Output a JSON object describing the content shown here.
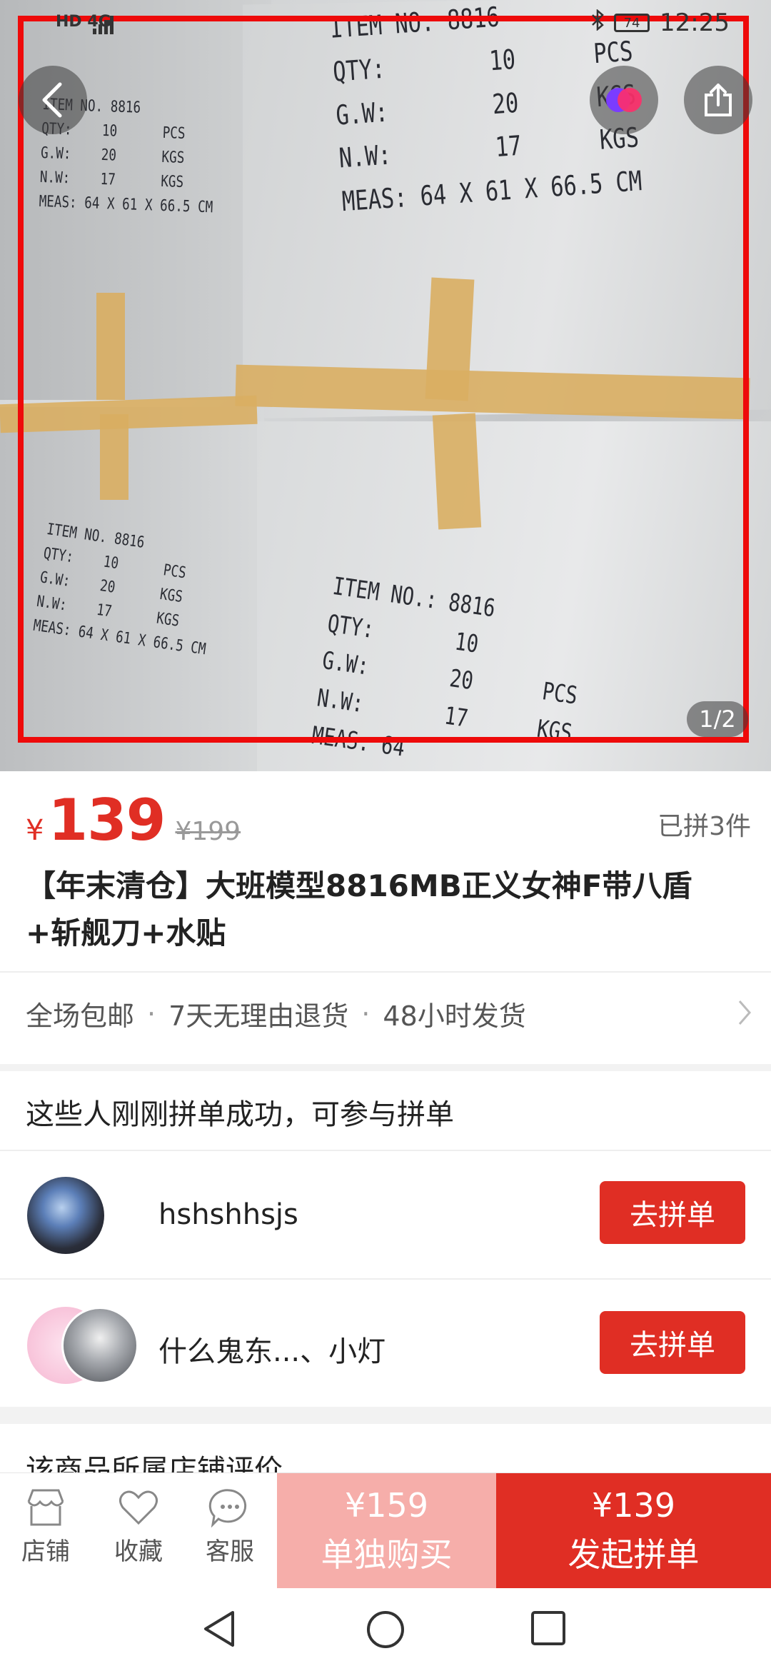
{
  "status_bar": {
    "network": "HD 4G",
    "battery": "74",
    "time": "12:25"
  },
  "hero": {
    "page_indicator": "1/2",
    "print_top_right": "ITEM NO. 8816\nQTY:        10      PCS\nG.W:        20      KGS\nN.W:        17      KGS\nMEAS: 64 X 61 X 66.5 CM",
    "print_top_left": "ITEM NO. 8816\nQTY:    10      PCS\nG.W:    20      KGS\nN.W:    17      KGS\nMEAS: 64 X 61 X 66.5 CM",
    "print_bottom_left": "ITEM NO. 8816\nQTY:    10      PCS\nG.W:    20      KGS\nN.W:    17      KGS\nMEAS: 64 X 61 X 66.5 CM",
    "print_bottom_right": "ITEM NO.: 8816\nQTY:       10\nG.W:       20      PCS\nN.W:       17      KGS\nMEAS: 64"
  },
  "product": {
    "currency": "¥",
    "price": "139",
    "original_price": "¥199",
    "sold": "已拼3件",
    "title": "【年末清仓】大班模型8816MB正义女神F带八盾+斩舰刀+水贴",
    "services": [
      "全场包邮",
      "7天无理由退货",
      "48小时发货"
    ]
  },
  "group_buy": {
    "heading": "这些人刚刚拼单成功，可参与拼单",
    "users": [
      {
        "name": "hshshhsjs",
        "button": "去拼单"
      },
      {
        "name": "什么鬼东...、小灯",
        "button": "去拼单"
      }
    ]
  },
  "store": {
    "heading": "该商品所属店铺评价"
  },
  "bottom_bar": {
    "shop": "店铺",
    "favorite": "收藏",
    "service": "客服",
    "alone_price": "¥159",
    "alone_label": "单独购买",
    "group_price": "¥139",
    "group_label": "发起拼单"
  },
  "colors": {
    "accent": "#e02e24",
    "accent_light": "#f6aeaa",
    "highlight": "#ee0a0a"
  }
}
